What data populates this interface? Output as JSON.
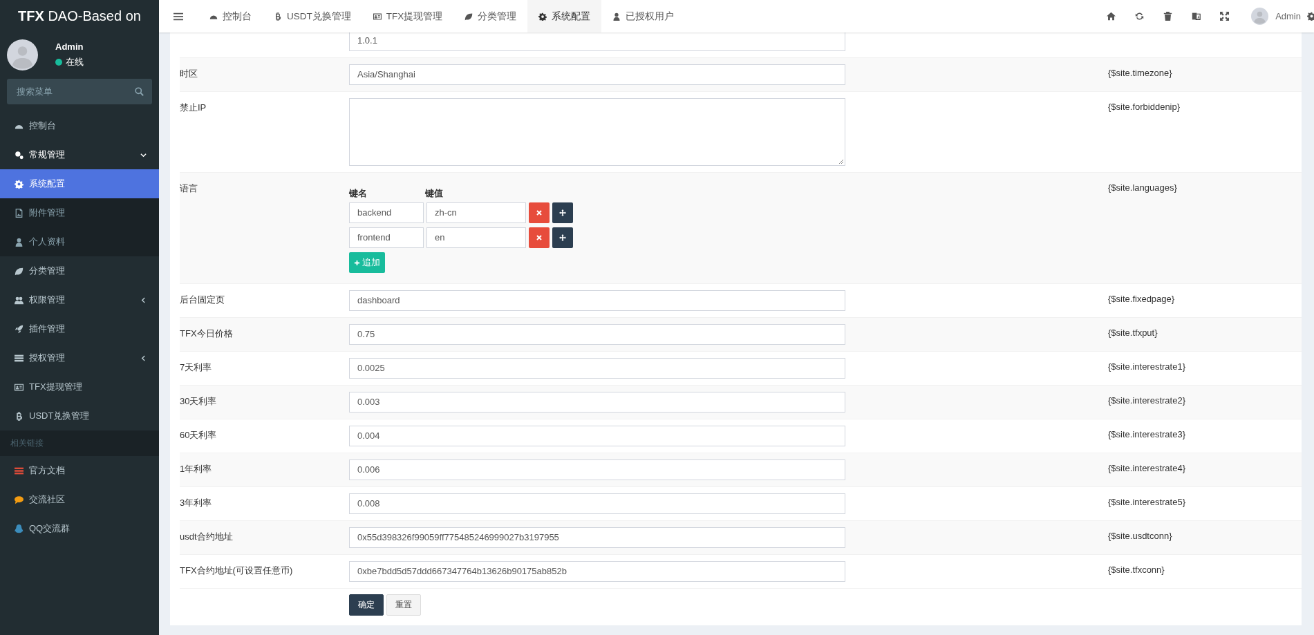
{
  "brand": {
    "strong": "TFX",
    "rest": "DAO-Based on"
  },
  "user": {
    "name": "Admin",
    "status": "在线"
  },
  "sidebar": {
    "search_placeholder": "搜索菜单",
    "items": [
      {
        "label": "控制台",
        "selected": false
      },
      {
        "label": "常规管理",
        "selected": false,
        "expanded": true,
        "children": [
          {
            "label": "系统配置",
            "selected": true
          },
          {
            "label": "附件管理",
            "selected": false
          },
          {
            "label": "个人资料",
            "selected": false
          }
        ]
      },
      {
        "label": "分类管理",
        "selected": false
      },
      {
        "label": "权限管理",
        "selected": false,
        "expanded": false
      },
      {
        "label": "插件管理",
        "selected": false
      },
      {
        "label": "授权管理",
        "selected": false,
        "expanded": false
      },
      {
        "label": "TFX提现管理",
        "selected": false
      },
      {
        "label": "USDT兑换管理",
        "selected": false
      }
    ],
    "section": "相关链接",
    "links": [
      {
        "label": "官方文档",
        "color": "#dd4b39"
      },
      {
        "label": "交流社区",
        "color": "#f39c12"
      },
      {
        "label": "QQ交流群",
        "color": "#3c8dbc"
      }
    ]
  },
  "tabs": [
    {
      "label": "控制台",
      "selected": false
    },
    {
      "label": "USDT兑换管理",
      "selected": false
    },
    {
      "label": "TFX提现管理",
      "selected": false
    },
    {
      "label": "分类管理",
      "selected": false
    },
    {
      "label": "系统配置",
      "selected": true
    },
    {
      "label": "已授权用户",
      "selected": false
    }
  ],
  "top_user": "Admin",
  "form": {
    "rows": [
      {
        "kind": "text",
        "value": "1.0.1"
      },
      {
        "kind": "text",
        "label": "时区",
        "value": "Asia/Shanghai",
        "tip": "{$site.timezone}"
      },
      {
        "kind": "textarea",
        "label": "禁止IP",
        "tip": "{$site.forbiddenip}"
      },
      {
        "kind": "keyvalue",
        "label": "语言",
        "tip": "{$site.languages}",
        "key_header": "键名",
        "value_header": "键值",
        "add": "追加",
        "pairs": [
          {
            "key": "backend",
            "value": "zh-cn"
          },
          {
            "key": "frontend",
            "value": "en"
          }
        ]
      },
      {
        "kind": "text",
        "label": "后台固定页",
        "value": "dashboard",
        "tip": "{$site.fixedpage}"
      },
      {
        "kind": "text",
        "label": "TFX今日价格",
        "value": "0.75",
        "tip": "{$site.tfxput}"
      },
      {
        "kind": "text",
        "label": "7天利率",
        "value": "0.0025",
        "tip": "{$site.interestrate1}"
      },
      {
        "kind": "text",
        "label": "30天利率",
        "value": "0.003",
        "tip": "{$site.interestrate2}"
      },
      {
        "kind": "text",
        "label": "60天利率",
        "value": "0.004",
        "tip": "{$site.interestrate3}"
      },
      {
        "kind": "text",
        "label": "1年利率",
        "value": "0.006",
        "tip": "{$site.interestrate4}"
      },
      {
        "kind": "text",
        "label": "3年利率",
        "value": "0.008",
        "tip": "{$site.interestrate5}"
      },
      {
        "kind": "text",
        "label": "usdt合约地址",
        "value": "0x55d398326f99059ff775485246999027b3197955",
        "tip": "{$site.usdtconn}"
      },
      {
        "kind": "text",
        "label": "TFX合约地址(可设置任意币)",
        "value": "0xbe7bdd5d57ddd667347764b13626b90175ab852b",
        "tip": "{$site.tfxconn}"
      }
    ],
    "buttons": [
      {
        "kind": "primary",
        "label": "确定"
      },
      {
        "kind": "default",
        "label": "重置"
      }
    ]
  }
}
